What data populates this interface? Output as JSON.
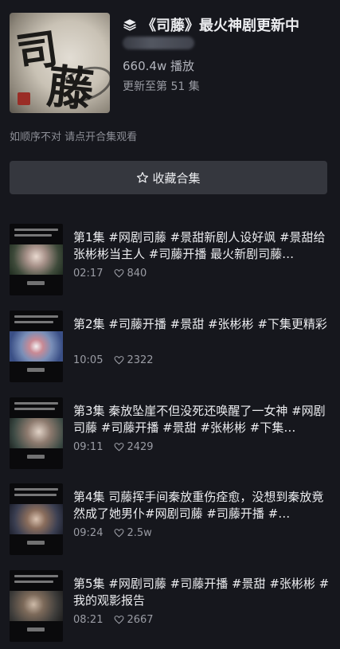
{
  "header": {
    "title": "《司藤》最火神剧更新中",
    "plays": "660.4w 播放",
    "updated": "更新至第 51 集",
    "cover_text_1": "司",
    "cover_text_2": "藤"
  },
  "hint": "如顺序不对  请点开合集观看",
  "favorite_button": {
    "label": "收藏合集",
    "icon": "star-icon"
  },
  "episodes": [
    {
      "text": "第1集 #网剧司藤 #景甜新剧人设好飒 #景甜给张彬彬当主人 #司藤开播 最火新剧司藤…",
      "duration": "02:17",
      "likes": "840"
    },
    {
      "text": "第2集 #司藤开播 #景甜 #张彬彬 #下集更精彩",
      "duration": "10:05",
      "likes": "2322"
    },
    {
      "text": "第3集 秦放坠崖不但没死还唤醒了一女神 #网剧司藤 #司藤开播 #景甜 #张彬彬 #下集…",
      "duration": "09:11",
      "likes": "2429"
    },
    {
      "text": "第4集 司藤挥手间秦放重伤痊愈，没想到秦放竟然成了她男仆#网剧司藤 #司藤开播 #…",
      "duration": "09:24",
      "likes": "2.5w"
    },
    {
      "text": "第5集 #网剧司藤 #司藤开播 #景甜 #张彬彬 #我的观影报告",
      "duration": "08:21",
      "likes": "2667"
    }
  ],
  "colors": {
    "background": "#16171d",
    "button_bg": "#35373e",
    "primary_text": "#ecedf0",
    "secondary_text": "#9a9ca4"
  }
}
